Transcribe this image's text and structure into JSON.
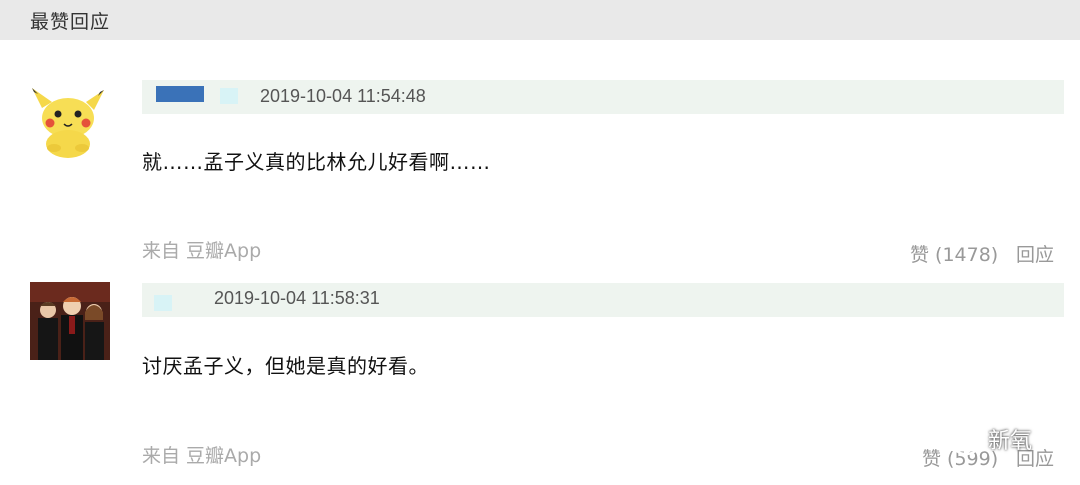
{
  "section": {
    "title": "最赞回应"
  },
  "comments": [
    {
      "timestamp": "2019-10-04 11:54:48",
      "text": "就……孟子义真的比林允儿好看啊……",
      "source": "来自 豆瓣App",
      "like_label": "赞 (1478)",
      "reply_label": "回应",
      "avatar_icon": "pikachu-avatar-icon"
    },
    {
      "timestamp": "2019-10-04 11:58:31",
      "text": "讨厌孟子义，但她是真的好看。",
      "source": "来自 豆瓣App",
      "like_label": "赞 (599)",
      "reply_label": "回应",
      "avatar_icon": "harry-potter-avatar-icon"
    }
  ],
  "watermark": {
    "text": "新氧",
    "icon": "wechat-icon"
  },
  "colors": {
    "header_bg": "#e9e9e9",
    "meta_bar_bg": "#eef4ef",
    "username_blur": "#3a72b8",
    "secondary_text": "#aaaaaa"
  }
}
